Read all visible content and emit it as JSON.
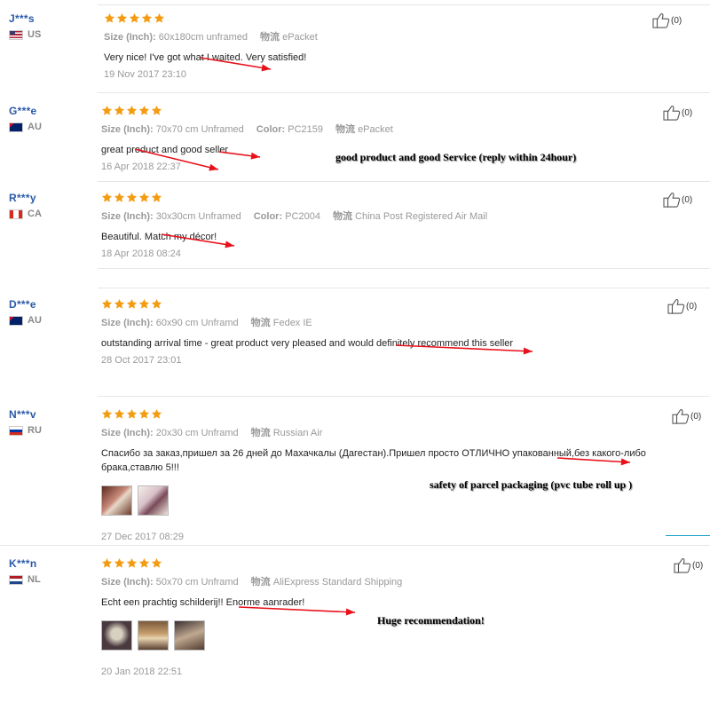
{
  "reviews": [
    {
      "buyer": "J***s",
      "country": "US",
      "rating": 5,
      "meta": [
        {
          "label": "Size (Inch):",
          "value": "60x180cm unframed"
        },
        {
          "label": "物流",
          "value": "ePacket"
        }
      ],
      "text": "Very nice! I've got what I waited. Very satisfied!",
      "date": "19 Nov 2017 23:10",
      "helpful": "(0)"
    },
    {
      "buyer": "G***e",
      "country": "AU",
      "rating": 5,
      "meta": [
        {
          "label": "Size (Inch):",
          "value": "70x70 cm Unframed"
        },
        {
          "label": "Color:",
          "value": "PC2159"
        },
        {
          "label": "物流",
          "value": "ePacket"
        }
      ],
      "text": "great product and good seller",
      "date": "16 Apr 2018 22:37",
      "helpful": "(0)",
      "callout": "good product  and  good Service (reply  within 24hour)"
    },
    {
      "buyer": "R***y",
      "country": "CA",
      "rating": 5,
      "meta": [
        {
          "label": "Size (Inch):",
          "value": "30x30cm Unframed"
        },
        {
          "label": "Color:",
          "value": "PC2004"
        },
        {
          "label": "物流",
          "value": "China Post Registered Air Mail"
        }
      ],
      "text": "Beautiful. Match my décor!",
      "date": "18 Apr 2018 08:24",
      "helpful": "(0)"
    },
    {
      "buyer": "D***e",
      "country": "AU",
      "rating": 5,
      "meta": [
        {
          "label": "Size (Inch):",
          "value": "60x90 cm Unframd"
        },
        {
          "label": "物流",
          "value": "Fedex IE"
        }
      ],
      "text": "outstanding arrival time - great product very pleased and would definitely recommend this seller",
      "date": "28 Oct 2017 23:01",
      "helpful": "(0)"
    },
    {
      "buyer": "N***v",
      "country": "RU",
      "rating": 5,
      "meta": [
        {
          "label": "Size (Inch):",
          "value": "20x30 cm Unframd"
        },
        {
          "label": "物流",
          "value": "Russian Air"
        }
      ],
      "text": "Спасибо за заказ,пришел за 26 дней до Махачкалы (Дагестан).Пришел просто ОТЛИЧНО упакованный,без какого-либо брака,ставлю 5!!!",
      "date": "27 Dec 2017 08:29",
      "helpful": "(0)",
      "photos": [
        "rolled painting tube",
        "cat painting in package"
      ],
      "callout": "safety of parcel packaging  (pvc tube  roll up )"
    },
    {
      "buyer": "K***n",
      "country": "NL",
      "rating": 5,
      "meta": [
        {
          "label": "Size (Inch):",
          "value": "50x70 cm Unframd"
        },
        {
          "label": "物流",
          "value": "AliExpress Standard Shipping"
        }
      ],
      "text": "Echt een prachtig schilderij!! Enorme aanrader!",
      "date": "20 Jan 2018 22:51",
      "helpful": "(0)",
      "photos": [
        "painting on wall 1",
        "painting on wall 2",
        "painting on wall 3"
      ],
      "callout": "Huge recommendation!"
    }
  ],
  "colors": {
    "star": "#f39c12",
    "buyer_name": "#2a5aa8",
    "arrow": "#e8101a",
    "meta_text": "#999999"
  }
}
